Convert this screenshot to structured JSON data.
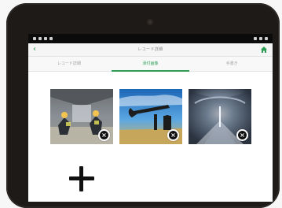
{
  "app": {
    "title": "レコード詳細"
  },
  "tabs": [
    {
      "label": "レコード詳細"
    },
    {
      "label": "添付画像"
    },
    {
      "label": "手書き"
    }
  ],
  "photos": [
    {
      "alt": "tunnel-workers"
    },
    {
      "alt": "oil-pumpjack"
    },
    {
      "alt": "tunnel-interior"
    }
  ]
}
